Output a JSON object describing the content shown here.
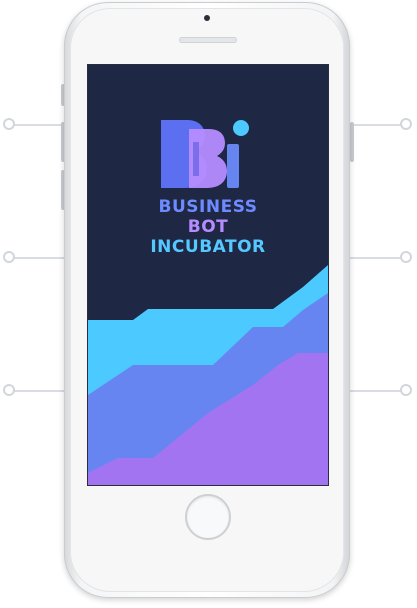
{
  "brand": {
    "line1": "BUSINESS",
    "line2": "BOT",
    "line3": "INCUBATOR",
    "logo_text": "BBi"
  },
  "colors": {
    "screen_bg": "#1e2744",
    "cyan": "#4cc9ff",
    "blue": "#6785f0",
    "purple": "#a374f2",
    "line1_color": "#6d8bff",
    "line2_color": "#b58cff",
    "line3_color": "#55c8ff"
  },
  "icons": {
    "logo": "bbi-logo-icon",
    "home": "home-button",
    "camera": "camera-icon",
    "speaker": "speaker-grille"
  }
}
